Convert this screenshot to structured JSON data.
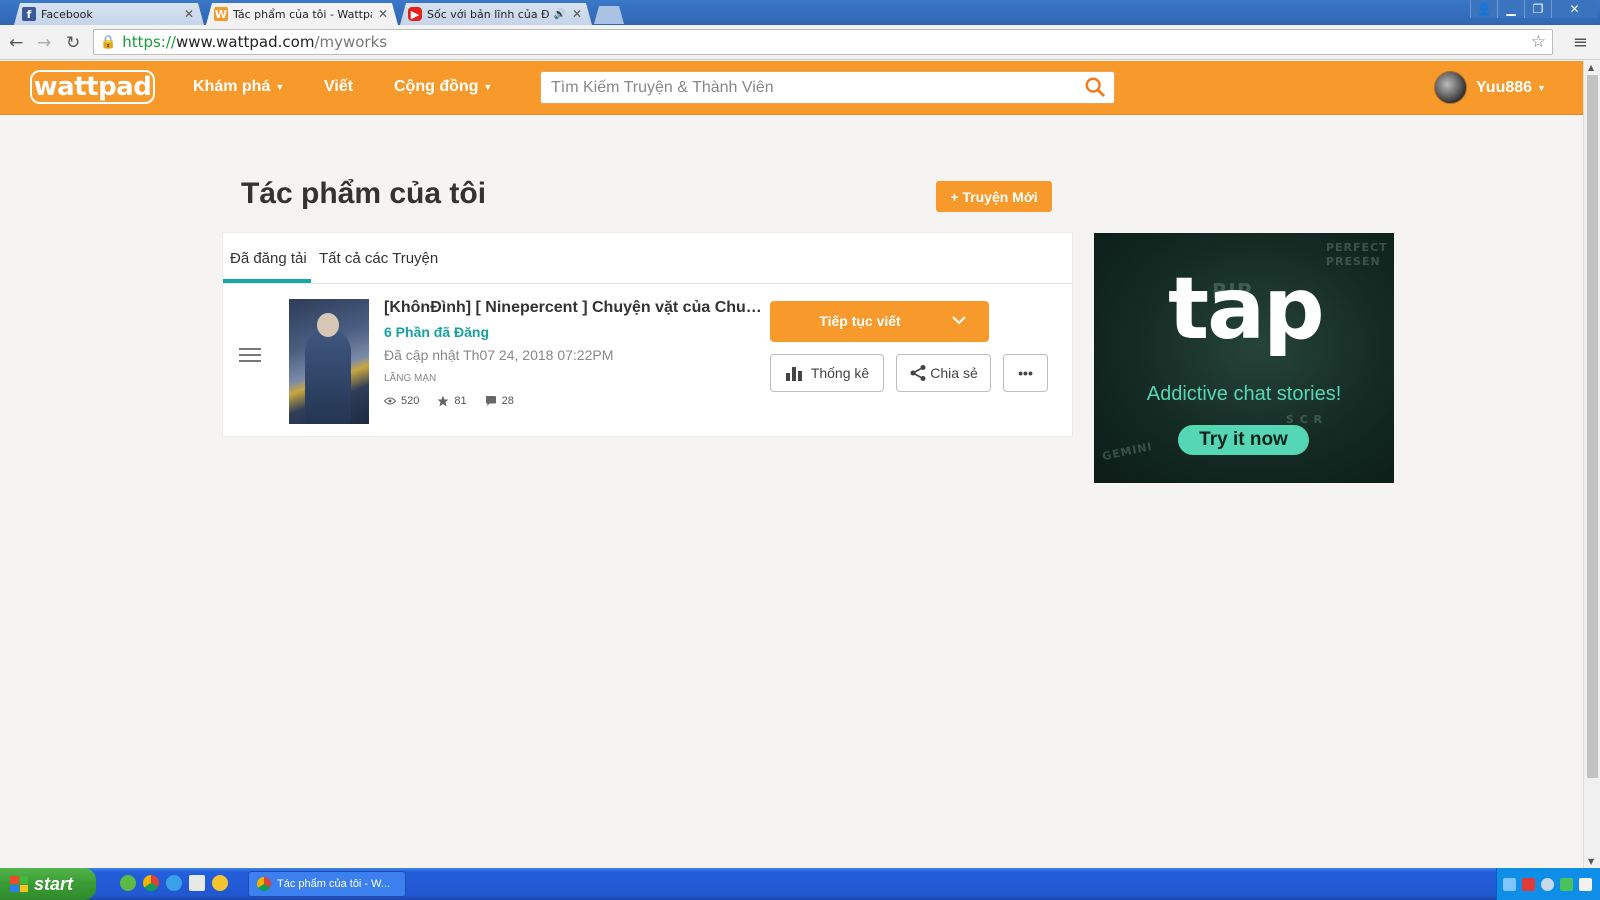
{
  "browser": {
    "tabs": [
      {
        "title": "Facebook",
        "favicon": "facebook-icon",
        "color": "#3b5998"
      },
      {
        "title": "Tác phẩm của tôi - Wattpad",
        "favicon": "wattpad-icon",
        "color": "#f79a2b"
      },
      {
        "title": "Sốc với bản lĩnh của Đại N",
        "favicon": "youtube-icon",
        "color": "#e62117"
      }
    ],
    "url": {
      "scheme": "https://",
      "host": "www.wattpad.com",
      "path": "/myworks"
    }
  },
  "header": {
    "logo": "wattpad",
    "nav": {
      "discover": "Khám phá",
      "write": "Viết",
      "community": "Cộng đồng"
    },
    "search_placeholder": "Tìm Kiếm Truyện & Thành Viên",
    "username": "Yuu886",
    "brand_color": "#f79a2b"
  },
  "main": {
    "title": "Tác phẩm của tôi",
    "new_story_label": "+ Truyện Mới",
    "tabs": [
      {
        "label": "Đã đăng tải",
        "active": true
      },
      {
        "label": "Tất cả các Truyện",
        "active": false
      }
    ],
    "story": {
      "title": "[KhônĐình] [ Ninepercent ] Chuyện vặt của Chuyện",
      "parts": "6 Phần đã Đăng",
      "updated": "Đã cập nhật Th07 24, 2018 07:22PM",
      "genre": "LÃNG MẠN",
      "views": "520",
      "votes": "81",
      "comments": "28"
    },
    "actions": {
      "continue": "Tiếp tục viết",
      "stats": "Thống kê",
      "share": "Chia sẻ",
      "more": "•••"
    }
  },
  "ad": {
    "brand": "tap",
    "tagline": "Addictive chat stories!",
    "cta": "Try it now",
    "ghost_text": [
      "PERFECT",
      "PRESEN",
      "GEMINI",
      "RIP",
      "S C R"
    ]
  },
  "taskbar": {
    "start_label": "start",
    "task_label": "Tác phẩm của tôi - W..."
  }
}
